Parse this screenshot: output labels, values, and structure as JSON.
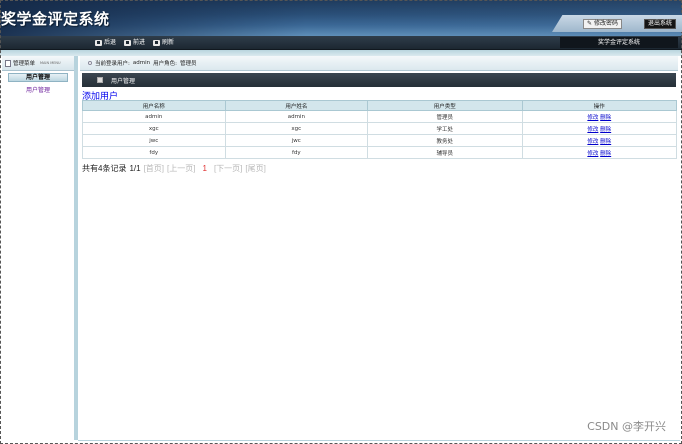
{
  "app": {
    "title": "奖学金评定系统",
    "change_password": "修改密码",
    "logout": "退出系统"
  },
  "nav": {
    "items": [
      {
        "label": "后退"
      },
      {
        "label": "前进"
      },
      {
        "label": "刷新"
      }
    ],
    "right_label": "奖学金评定系统"
  },
  "sidebar": {
    "header": "管理菜单",
    "header_en": "MAIN MENU",
    "group": "用户管理",
    "items": [
      {
        "label": "用户管理"
      }
    ]
  },
  "userinfo": {
    "label": "当前登录用户:",
    "user": "admin",
    "role_label": "用户角色:",
    "role": "管理员"
  },
  "section": {
    "title": "用户管理"
  },
  "add_user_link": "添加用户",
  "table": {
    "columns": [
      "用户名称",
      "用户姓名",
      "用户类型",
      "操作"
    ],
    "rows": [
      {
        "username": "admin",
        "name": "admin",
        "type": "管理员",
        "edit": "修改",
        "delete": "删除"
      },
      {
        "username": "xgc",
        "name": "xgc",
        "type": "学工处",
        "edit": "修改",
        "delete": "删除"
      },
      {
        "username": "jwc",
        "name": "jwc",
        "type": "教务处",
        "edit": "修改",
        "delete": "删除"
      },
      {
        "username": "fdy",
        "name": "fdy",
        "type": "辅导员",
        "edit": "修改",
        "delete": "删除"
      }
    ]
  },
  "pager": {
    "summary": "共有4条记录",
    "page": "1/1",
    "first": "[首页]",
    "prev": "[上一页]",
    "current": "1",
    "next": "[下一页]",
    "last": "[尾页]"
  },
  "watermark": "CSDN @李开兴"
}
